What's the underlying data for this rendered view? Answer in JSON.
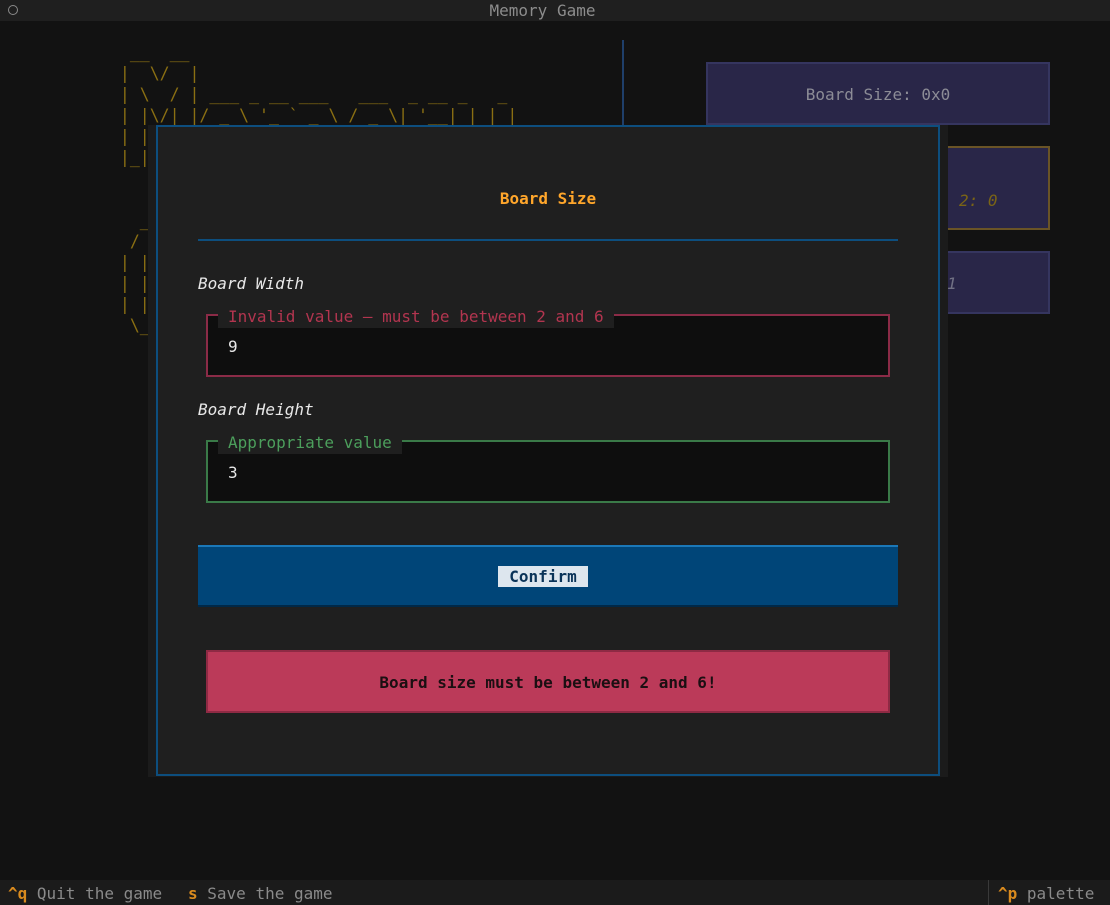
{
  "app": {
    "title": "Memory Game"
  },
  "background": {
    "ascii_top": "  __  __\n |  \\/  |\n | \\  / | ___ _ __ ___   ___  _ __ _   _\n | |\\/| |/ _ \\ '_ ` _ \\ / _ \\| '__| | | |\n | |  | |\n |_|  |_|",
    "ascii_bottom": "   __\n  / _\n | |\n | |\n | |_\n  \\__",
    "board_size_label": "Board Size: 0x0",
    "score_label": "2: 0",
    "turn_label": "1"
  },
  "modal": {
    "title": "Board Size",
    "width_label": "Board Width",
    "width_validation": "Invalid value — must be between 2 and 6",
    "width_value": "9",
    "height_label": "Board Height",
    "height_validation": "Appropriate value",
    "height_value": "3",
    "confirm_label": "Confirm",
    "error_message": "Board size must be between 2 and 6!"
  },
  "footer": {
    "quit_key": "^q",
    "quit_label": "Quit the game",
    "save_key": "s",
    "save_label": "Save the game",
    "palette_key": "^p",
    "palette_label": "palette"
  }
}
